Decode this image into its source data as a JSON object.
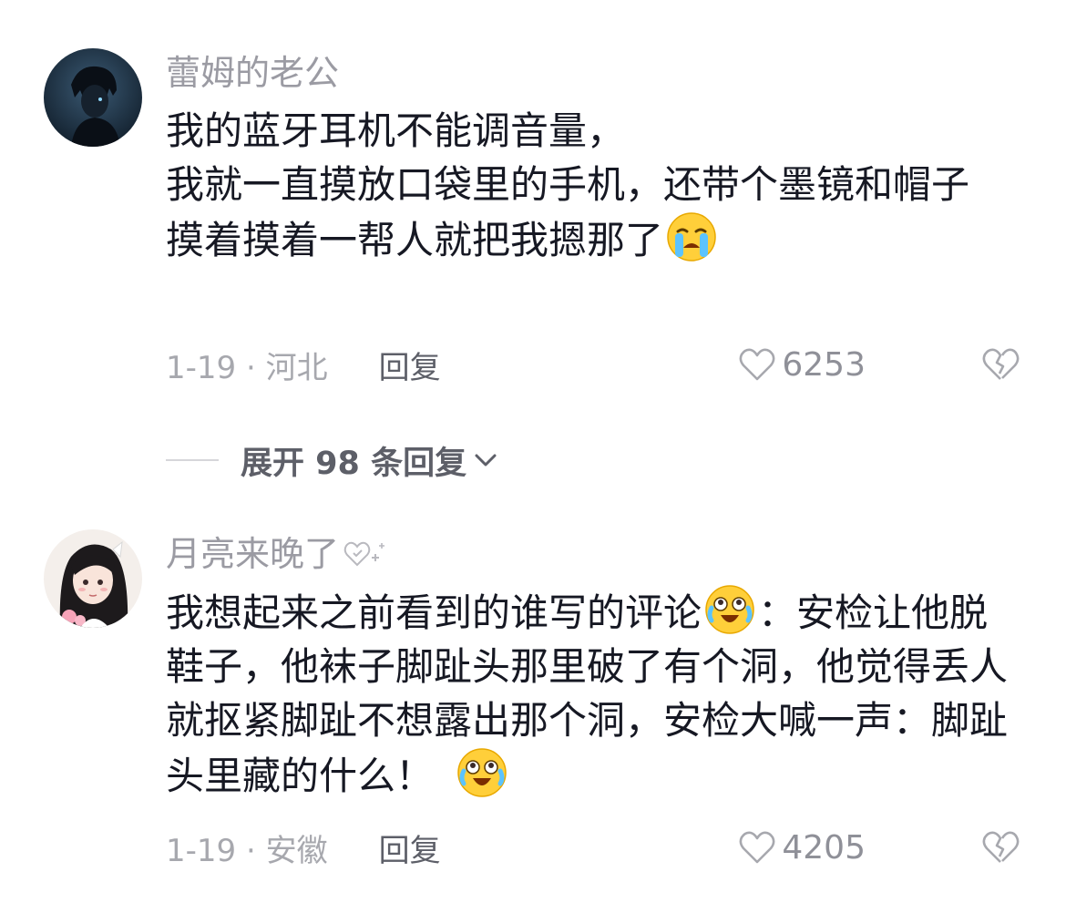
{
  "comments": [
    {
      "username": "蕾姆的老公",
      "lines": [
        "我的蓝牙耳机不能调音量，",
        "我就一直摸放口袋里的手机，还带个墨镜和帽子",
        "摸着摸着一帮人就把我摁那了"
      ],
      "date_location": "1-19 · 河北",
      "reply_label": "回复",
      "like_count": "6253"
    },
    {
      "username": "月亮来晚了",
      "content_part1": "我想起来之前看到的谁写的评论",
      "content_part2": "：安检让他脱鞋子，他袜子脚趾头那里破了有个洞，他觉得丢人就抠紧脚趾不想露出那个洞，安检大喊一声：脚趾头里藏的什么！",
      "date_location": "1-19 · 安徽",
      "reply_label": "回复",
      "like_count": "4205"
    }
  ],
  "expand_replies": {
    "label": "展开 98 条回复"
  },
  "icons": {
    "like": "heart-outline-icon",
    "dislike": "broken-heart-icon",
    "expand": "chevron-down-icon",
    "emoji_cry": "loudly-crying-emoji-icon",
    "emoji_laugh_cry": "laughing-crying-emoji-icon"
  },
  "colors": {
    "username": "#9b9ba3",
    "text": "#161823",
    "meta": "#a7a8ae",
    "reply": "#5d5f68"
  }
}
